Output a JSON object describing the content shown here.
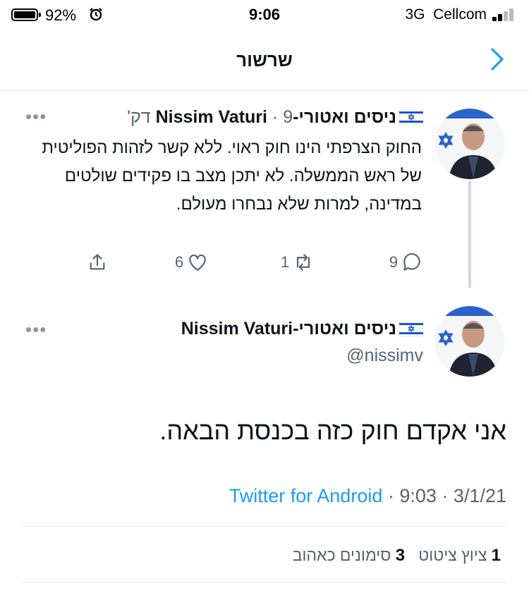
{
  "status_bar": {
    "battery": "92%",
    "time": "9:06",
    "network": "3G",
    "carrier": "Cellcom"
  },
  "header": {
    "title": "שרשור"
  },
  "parent_tweet": {
    "display_name": "ניסים ואטורי-Nissim Vaturi",
    "time_ago": "9 דק'",
    "text": "החוק הצרפתי הינו חוק ראוי. ללא קשר לזהות הפוליטית של ראש הממשלה. לא יתכן מצב בו פקידים שולטים במדינה, למרות שלא נבחרו מעולם.",
    "replies": "9",
    "retweets": "1",
    "likes": "6"
  },
  "main_tweet": {
    "display_name": "ניסים ואטורי-Nissim Vaturi",
    "handle": "@nissimv",
    "text": "אני אקדם חוק כזה בכנסת הבאה.",
    "date": "3/1/21",
    "time": "9:03",
    "source": "Twitter for Android",
    "quote_tweets_count": "1",
    "quote_tweets_label": "ציוץ ציטוט",
    "likes_count": "3",
    "likes_label": "סימונים כאהוב"
  },
  "colors": {
    "accent": "#1d9bf0",
    "secondary_text": "#536471",
    "divider": "#e6ecf0"
  }
}
